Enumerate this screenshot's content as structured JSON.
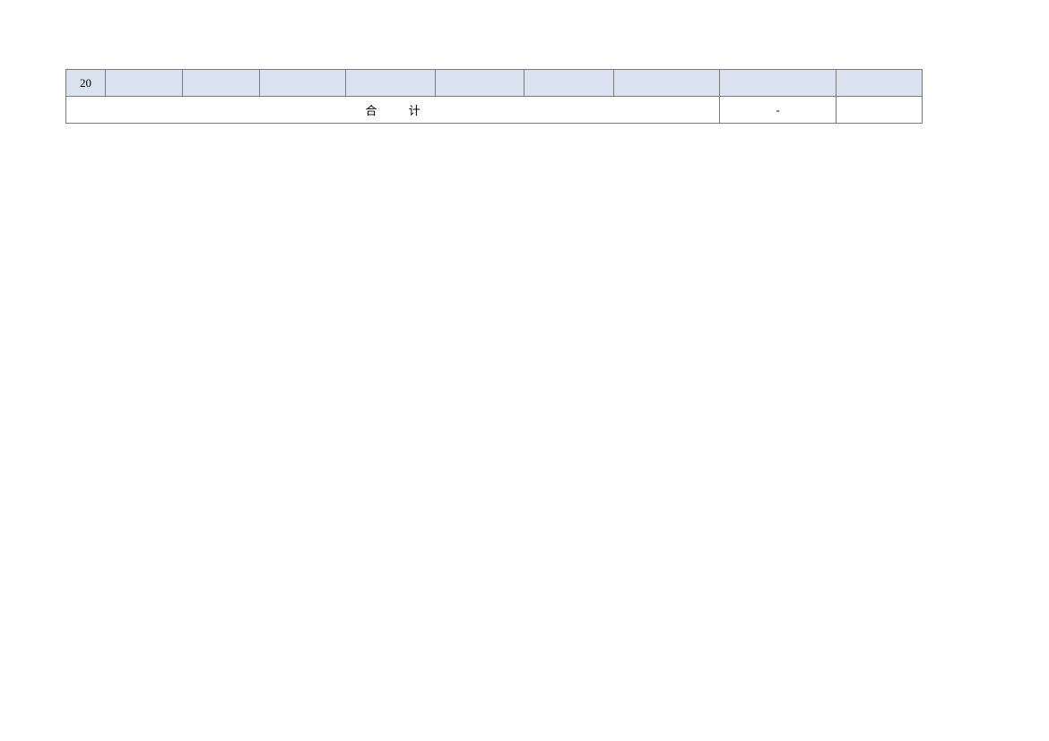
{
  "table": {
    "header_row": {
      "row_number": "20",
      "cells": [
        "",
        "",
        "",
        "",
        "",
        "",
        "",
        "",
        ""
      ]
    },
    "total_row": {
      "label": "合 计",
      "value": "-",
      "last": ""
    }
  }
}
